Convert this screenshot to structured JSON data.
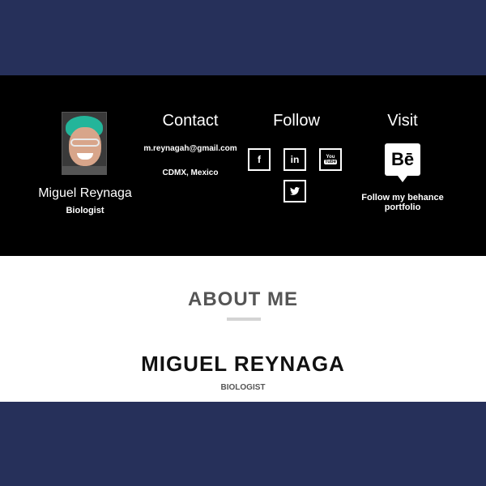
{
  "profile": {
    "name": "Miguel Reynaga",
    "role": "Biologist"
  },
  "contact": {
    "title": "Contact",
    "email": "m.reynagah@gmail.com",
    "location": "CDMX, Mexico"
  },
  "follow": {
    "title": "Follow",
    "icons": [
      "facebook-icon",
      "linkedin-icon",
      "youtube-icon",
      "twitter-icon"
    ],
    "facebook_glyph": "f",
    "linkedin_glyph": "in",
    "youtube_top": "You",
    "youtube_bottom": "Tube",
    "twitter_glyph": "🐦"
  },
  "visit": {
    "title": "Visit",
    "badge": "Bē",
    "link_text": "Follow my behance portfolio"
  },
  "about": {
    "heading": "ABOUT ME",
    "name": "MIGUEL REYNAGA",
    "role": "BIOLOGIST"
  },
  "colors": {
    "navy": "#26305a",
    "black": "#000000",
    "white": "#ffffff"
  }
}
